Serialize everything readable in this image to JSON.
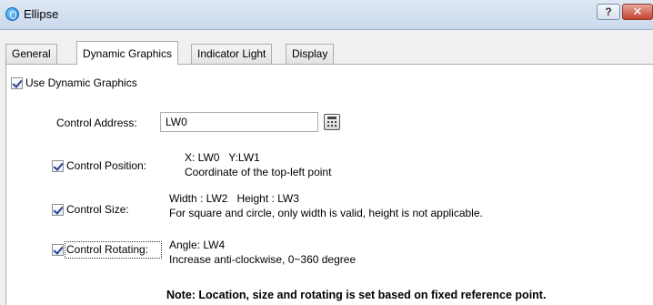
{
  "window": {
    "title": "Ellipse",
    "help_label": "?",
    "close_label": "✕"
  },
  "tabs": [
    {
      "label": "General",
      "active": false
    },
    {
      "label": "Dynamic Graphics",
      "active": true
    },
    {
      "label": "Indicator Light",
      "active": false
    },
    {
      "label": "Display",
      "active": false
    }
  ],
  "use_dynamic": {
    "label": "Use Dynamic Graphics",
    "checked": true
  },
  "control_address": {
    "label": "Control Address:",
    "value": "LW0",
    "button_icon": "calculator-icon"
  },
  "control_position": {
    "label": "Control Position:",
    "checked": true,
    "line1": "X: LW0   Y:LW1",
    "line2": "Coordinate of the top-left point"
  },
  "control_size": {
    "label": "Control Size:",
    "checked": true,
    "line1": "Width : LW2   Height : LW3",
    "line2": "For square and circle, only width is valid, height is not applicable."
  },
  "control_rotating": {
    "label": "Control Rotating:",
    "checked": true,
    "line1": "Angle: LW4",
    "line2": "Increase anti-clockwise, 0~360 degree"
  },
  "note": "Note: Location, size and rotating is set based on fixed reference point."
}
